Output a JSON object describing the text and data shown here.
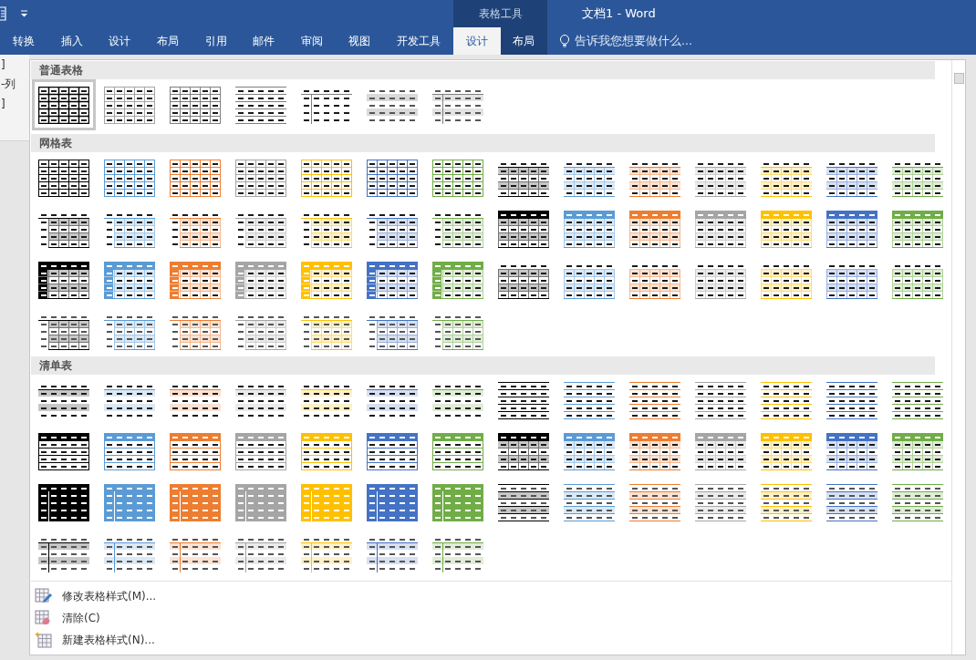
{
  "title_bar": {
    "context_group": "表格工具",
    "title": "文档1 - Word"
  },
  "tabs": [
    {
      "label": "转换",
      "selected": false,
      "contextual": false
    },
    {
      "label": "插入",
      "selected": false,
      "contextual": false
    },
    {
      "label": "设计",
      "selected": false,
      "contextual": false
    },
    {
      "label": "布局",
      "selected": false,
      "contextual": false
    },
    {
      "label": "引用",
      "selected": false,
      "contextual": false
    },
    {
      "label": "邮件",
      "selected": false,
      "contextual": false
    },
    {
      "label": "审阅",
      "selected": false,
      "contextual": false
    },
    {
      "label": "视图",
      "selected": false,
      "contextual": false
    },
    {
      "label": "开发工具",
      "selected": false,
      "contextual": false
    },
    {
      "label": "设计",
      "selected": true,
      "contextual": true
    },
    {
      "label": "布局",
      "selected": false,
      "contextual": true
    }
  ],
  "tell_me": {
    "placeholder": "告诉我您想要做什么..."
  },
  "ribbon_left_labels": [
    "]",
    "-列",
    "]"
  ],
  "sections": [
    {
      "title": "普通表格",
      "styles": [
        {
          "kind": "grid-bold",
          "color": "#000000",
          "selected": true
        },
        {
          "kind": "grid-light",
          "color": "#a5a5a5",
          "selected": false
        },
        {
          "kind": "grid-light",
          "color": "#7f7f7f",
          "selected": false
        },
        {
          "kind": "hlines",
          "color": "#7f7f7f",
          "selected": false
        },
        {
          "kind": "header-col-line",
          "color": "#7f7f7f",
          "selected": false
        },
        {
          "kind": "band-plain",
          "color": "#d9d9d9",
          "selected": false
        },
        {
          "kind": "header-col-line-band",
          "color": "#7f7f7f",
          "selected": false
        }
      ]
    },
    {
      "title": "网格表",
      "styles": [
        {
          "kind": "grid-1",
          "color": "#000000",
          "selected": false
        },
        {
          "kind": "grid-1",
          "color": "#5b9bd5",
          "selected": false
        },
        {
          "kind": "grid-1",
          "color": "#ed7d31",
          "selected": false
        },
        {
          "kind": "grid-1",
          "color": "#a5a5a5",
          "selected": false
        },
        {
          "kind": "grid-1",
          "color": "#ffc000",
          "selected": false
        },
        {
          "kind": "grid-1",
          "color": "#4472c4",
          "selected": false
        },
        {
          "kind": "grid-1",
          "color": "#70ad47",
          "selected": false
        },
        {
          "kind": "grid-2",
          "color": "#000000",
          "selected": false
        },
        {
          "kind": "grid-2",
          "color": "#5b9bd5",
          "selected": false
        },
        {
          "kind": "grid-2",
          "color": "#ed7d31",
          "selected": false
        },
        {
          "kind": "grid-2",
          "color": "#a5a5a5",
          "selected": false
        },
        {
          "kind": "grid-2",
          "color": "#ffc000",
          "selected": false
        },
        {
          "kind": "grid-2",
          "color": "#4472c4",
          "selected": false
        },
        {
          "kind": "grid-2",
          "color": "#70ad47",
          "selected": false
        },
        {
          "kind": "grid-3",
          "color": "#000000",
          "selected": false
        },
        {
          "kind": "grid-3",
          "color": "#5b9bd5",
          "selected": false
        },
        {
          "kind": "grid-3",
          "color": "#ed7d31",
          "selected": false
        },
        {
          "kind": "grid-3",
          "color": "#a5a5a5",
          "selected": false
        },
        {
          "kind": "grid-3",
          "color": "#ffc000",
          "selected": false
        },
        {
          "kind": "grid-3",
          "color": "#4472c4",
          "selected": false
        },
        {
          "kind": "grid-3",
          "color": "#70ad47",
          "selected": false
        },
        {
          "kind": "grid-4",
          "color": "#000000",
          "selected": false
        },
        {
          "kind": "grid-4",
          "color": "#5b9bd5",
          "selected": false
        },
        {
          "kind": "grid-4",
          "color": "#ed7d31",
          "selected": false
        },
        {
          "kind": "grid-4",
          "color": "#a5a5a5",
          "selected": false
        },
        {
          "kind": "grid-4",
          "color": "#ffc000",
          "selected": false
        },
        {
          "kind": "grid-4",
          "color": "#4472c4",
          "selected": false
        },
        {
          "kind": "grid-4",
          "color": "#70ad47",
          "selected": false
        },
        {
          "kind": "grid-5",
          "color": "#000000",
          "selected": false
        },
        {
          "kind": "grid-5",
          "color": "#5b9bd5",
          "selected": false
        },
        {
          "kind": "grid-5",
          "color": "#ed7d31",
          "selected": false
        },
        {
          "kind": "grid-5",
          "color": "#a5a5a5",
          "selected": false
        },
        {
          "kind": "grid-5",
          "color": "#ffc000",
          "selected": false
        },
        {
          "kind": "grid-5",
          "color": "#4472c4",
          "selected": false
        },
        {
          "kind": "grid-5",
          "color": "#70ad47",
          "selected": false
        },
        {
          "kind": "grid-6",
          "color": "#000000",
          "selected": false
        },
        {
          "kind": "grid-6",
          "color": "#5b9bd5",
          "selected": false
        },
        {
          "kind": "grid-6",
          "color": "#ed7d31",
          "selected": false
        },
        {
          "kind": "grid-6",
          "color": "#a5a5a5",
          "selected": false
        },
        {
          "kind": "grid-6",
          "color": "#ffc000",
          "selected": false
        },
        {
          "kind": "grid-6",
          "color": "#4472c4",
          "selected": false
        },
        {
          "kind": "grid-6",
          "color": "#70ad47",
          "selected": false
        },
        {
          "kind": "grid-7",
          "color": "#000000",
          "selected": false
        },
        {
          "kind": "grid-7",
          "color": "#5b9bd5",
          "selected": false
        },
        {
          "kind": "grid-7",
          "color": "#ed7d31",
          "selected": false
        },
        {
          "kind": "grid-7",
          "color": "#a5a5a5",
          "selected": false
        },
        {
          "kind": "grid-7",
          "color": "#ffc000",
          "selected": false
        },
        {
          "kind": "grid-7",
          "color": "#4472c4",
          "selected": false
        },
        {
          "kind": "grid-7",
          "color": "#70ad47",
          "selected": false
        }
      ]
    },
    {
      "title": "清单表",
      "styles": [
        {
          "kind": "list-1",
          "color": "#000000",
          "selected": false
        },
        {
          "kind": "list-1",
          "color": "#5b9bd5",
          "selected": false
        },
        {
          "kind": "list-1",
          "color": "#ed7d31",
          "selected": false
        },
        {
          "kind": "list-1",
          "color": "#a5a5a5",
          "selected": false
        },
        {
          "kind": "list-1",
          "color": "#ffc000",
          "selected": false
        },
        {
          "kind": "list-1",
          "color": "#4472c4",
          "selected": false
        },
        {
          "kind": "list-1",
          "color": "#70ad47",
          "selected": false
        },
        {
          "kind": "list-2",
          "color": "#000000",
          "selected": false
        },
        {
          "kind": "list-2",
          "color": "#5b9bd5",
          "selected": false
        },
        {
          "kind": "list-2",
          "color": "#ed7d31",
          "selected": false
        },
        {
          "kind": "list-2",
          "color": "#a5a5a5",
          "selected": false
        },
        {
          "kind": "list-2",
          "color": "#ffc000",
          "selected": false
        },
        {
          "kind": "list-2",
          "color": "#4472c4",
          "selected": false
        },
        {
          "kind": "list-2",
          "color": "#70ad47",
          "selected": false
        },
        {
          "kind": "list-3",
          "color": "#000000",
          "selected": false
        },
        {
          "kind": "list-3",
          "color": "#5b9bd5",
          "selected": false
        },
        {
          "kind": "list-3",
          "color": "#ed7d31",
          "selected": false
        },
        {
          "kind": "list-3",
          "color": "#a5a5a5",
          "selected": false
        },
        {
          "kind": "list-3",
          "color": "#ffc000",
          "selected": false
        },
        {
          "kind": "list-3",
          "color": "#4472c4",
          "selected": false
        },
        {
          "kind": "list-3",
          "color": "#70ad47",
          "selected": false
        },
        {
          "kind": "list-4",
          "color": "#000000",
          "selected": false
        },
        {
          "kind": "list-4",
          "color": "#5b9bd5",
          "selected": false
        },
        {
          "kind": "list-4",
          "color": "#ed7d31",
          "selected": false
        },
        {
          "kind": "list-4",
          "color": "#a5a5a5",
          "selected": false
        },
        {
          "kind": "list-4",
          "color": "#ffc000",
          "selected": false
        },
        {
          "kind": "list-4",
          "color": "#4472c4",
          "selected": false
        },
        {
          "kind": "list-4",
          "color": "#70ad47",
          "selected": false
        },
        {
          "kind": "list-5",
          "color": "#000000",
          "selected": false
        },
        {
          "kind": "list-5",
          "color": "#5b9bd5",
          "selected": false
        },
        {
          "kind": "list-5",
          "color": "#ed7d31",
          "selected": false
        },
        {
          "kind": "list-5",
          "color": "#a5a5a5",
          "selected": false
        },
        {
          "kind": "list-5",
          "color": "#ffc000",
          "selected": false
        },
        {
          "kind": "list-5",
          "color": "#4472c4",
          "selected": false
        },
        {
          "kind": "list-5",
          "color": "#70ad47",
          "selected": false
        },
        {
          "kind": "list-6",
          "color": "#000000",
          "selected": false
        },
        {
          "kind": "list-6",
          "color": "#5b9bd5",
          "selected": false
        },
        {
          "kind": "list-6",
          "color": "#ed7d31",
          "selected": false
        },
        {
          "kind": "list-6",
          "color": "#a5a5a5",
          "selected": false
        },
        {
          "kind": "list-6",
          "color": "#ffc000",
          "selected": false
        },
        {
          "kind": "list-6",
          "color": "#4472c4",
          "selected": false
        },
        {
          "kind": "list-6",
          "color": "#70ad47",
          "selected": false
        },
        {
          "kind": "list-7",
          "color": "#000000",
          "selected": false
        },
        {
          "kind": "list-7",
          "color": "#5b9bd5",
          "selected": false
        },
        {
          "kind": "list-7",
          "color": "#ed7d31",
          "selected": false
        },
        {
          "kind": "list-7",
          "color": "#a5a5a5",
          "selected": false
        },
        {
          "kind": "list-7",
          "color": "#ffc000",
          "selected": false
        },
        {
          "kind": "list-7",
          "color": "#4472c4",
          "selected": false
        },
        {
          "kind": "list-7",
          "color": "#70ad47",
          "selected": false
        }
      ]
    }
  ],
  "menu": [
    {
      "kind": "modify",
      "label": "修改表格样式(M)..."
    },
    {
      "kind": "clear",
      "label": "清除(C)"
    },
    {
      "kind": "new",
      "label": "新建表格样式(N)..."
    }
  ]
}
